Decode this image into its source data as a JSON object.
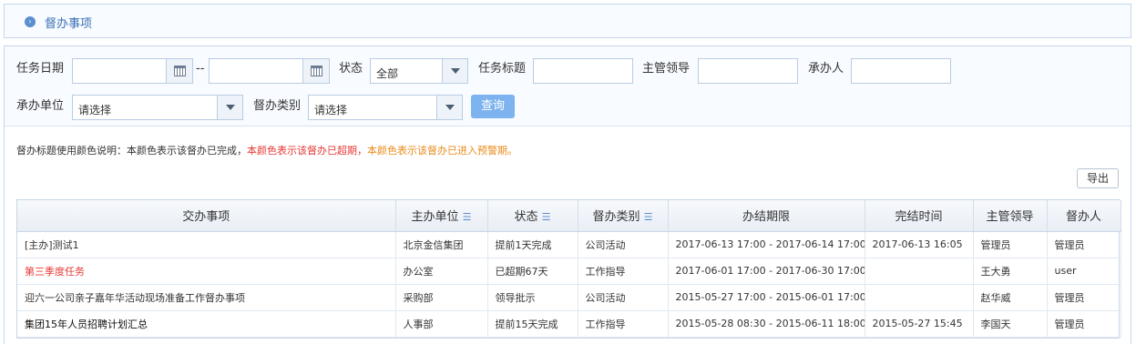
{
  "header": {
    "title": "督办事项"
  },
  "filters": {
    "task_date_label": "任务日期",
    "date_separator": "--",
    "status_label": "状态",
    "status_value": "全部",
    "task_title_label": "任务标题",
    "leader_label": "主管领导",
    "handler_label": "承办人",
    "unit_label": "承办单位",
    "unit_placeholder": "请选择",
    "category_label": "督办类别",
    "category_placeholder": "请选择",
    "query_label": "查询"
  },
  "legend_note": {
    "prefix": "督办标题使用颜色说明：本颜色表示该督办已完成，",
    "overdue": "本颜色表示该督办已超期，",
    "warning": "本颜色表示该督办已进入预警期。"
  },
  "export_label": "导出",
  "table": {
    "columns": [
      "交办事项",
      "主办单位",
      "状态",
      "督办类别",
      "办结期限",
      "完结时间",
      "主管领导",
      "督办人"
    ],
    "rows": [
      [
        "[主办]测试1",
        "北京金信集团",
        "提前1天完成",
        "公司活动",
        "2017-06-13 17:00 - 2017-06-14 17:00",
        "2017-06-13 16:05",
        "管理员",
        "管理员"
      ],
      [
        "第三季度任务",
        "办公室",
        "已超期67天",
        "工作指导",
        "2017-06-01 17:00 - 2017-06-30 17:00",
        "",
        "王大勇",
        "user"
      ],
      [
        "迎六一公司亲子嘉年华活动现场准备工作督办事项",
        "采购部",
        "领导批示",
        "公司活动",
        "2015-05-27 17:00 - 2015-06-01 17:00",
        "",
        "赵华威",
        "管理员"
      ],
      [
        "集团15年人员招聘计划汇总",
        "人事部",
        "提前15天完成",
        "工作指导",
        "2015-05-28 08:30 - 2015-06-11 18:00",
        "2015-05-27 15:45",
        "李国天",
        "管理员"
      ]
    ]
  },
  "colors": {
    "accent": "#5b8fd0",
    "overdue": "#e53935",
    "warning": "#e98b1a"
  }
}
